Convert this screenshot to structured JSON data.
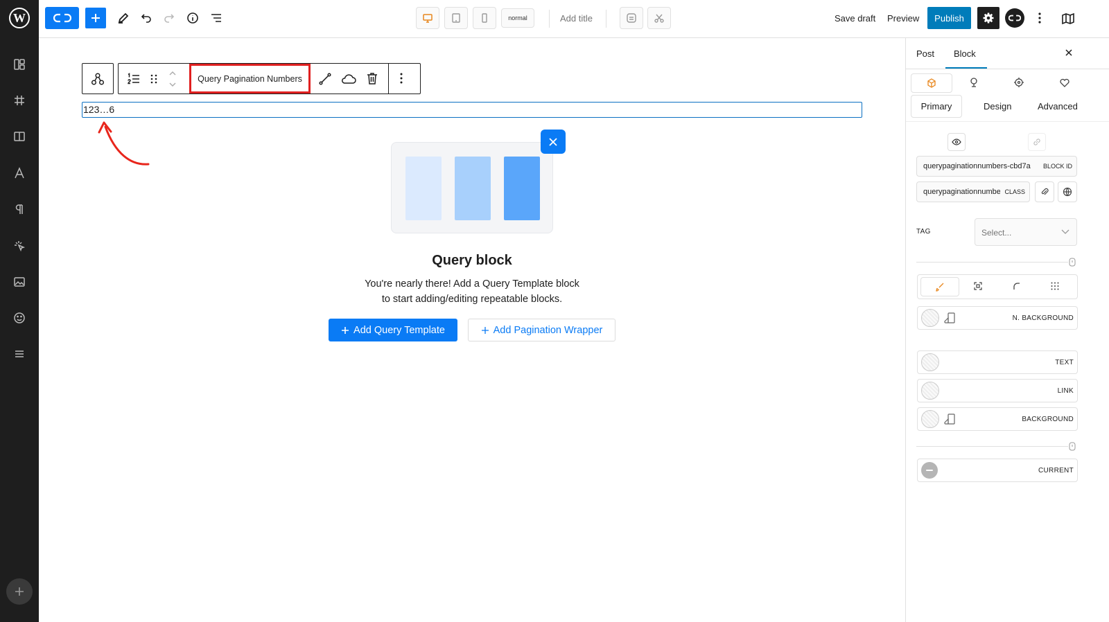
{
  "topbar": {
    "device_mode": "normal",
    "add_title": "Add title",
    "save_draft": "Save draft",
    "preview": "Preview",
    "publish": "Publish"
  },
  "toolbar": {
    "block_name": "Query Pagination Numbers"
  },
  "canvas": {
    "pagination_text": "123…6",
    "placeholder_title": "Query block",
    "placeholder_desc_1": "You're nearly there! Add a Query Template block",
    "placeholder_desc_2": "to start adding/editing repeatable blocks.",
    "add_template_label": "Add Query Template",
    "add_wrapper_label": "Add Pagination Wrapper"
  },
  "sidebar": {
    "tabs": [
      "Post",
      "Block"
    ],
    "subtabs": [
      "Primary",
      "Design",
      "Advanced"
    ],
    "block_id_value": "querypaginationnumbers-cbd7a",
    "block_id_label": "BLOCK ID",
    "class_value": "querypaginationnumbers",
    "class_label": "CLASS",
    "tag_label": "TAG",
    "tag_placeholder": "Select...",
    "color_rows": [
      "N. BACKGROUND",
      "TEXT",
      "LINK",
      "BACKGROUND",
      "CURRENT"
    ]
  },
  "colors": {
    "accent": "#0a7bf5",
    "wp_blue": "#007cba",
    "highlight": "#e02020",
    "arrow": "#e8261c"
  }
}
